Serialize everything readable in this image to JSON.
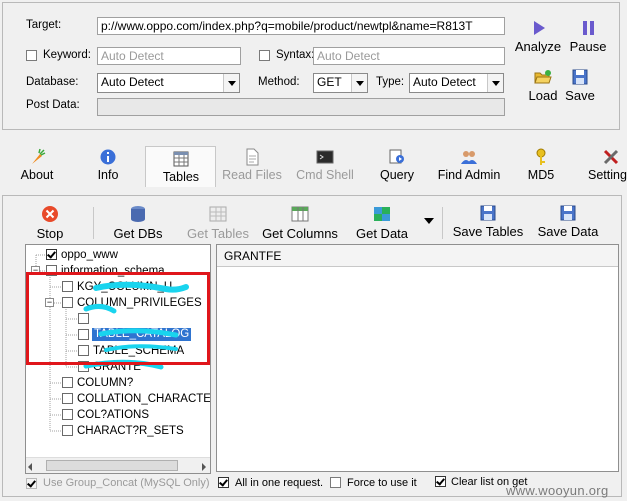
{
  "form": {
    "target_label": "Target:",
    "target_value": "p://www.oppo.com/index.php?q=mobile/product/newtpl&name=R813T",
    "keyword_label": "Keyword:",
    "keyword_placeholder": "Auto Detect",
    "syntax_label": "Syntax:",
    "syntax_placeholder": "Auto Detect",
    "database_label": "Database:",
    "database_value": "Auto Detect",
    "method_label": "Method:",
    "method_value": "GET",
    "type_label": "Type:",
    "type_value": "Auto Detect",
    "postdata_label": "Post Data:"
  },
  "actions": {
    "analyze": "Analyze",
    "pause": "Pause",
    "load": "Load",
    "save": "Save"
  },
  "tabs": [
    {
      "label": "About",
      "icon": "carrot-icon"
    },
    {
      "label": "Info",
      "icon": "info-icon"
    },
    {
      "label": "Tables",
      "icon": "table-icon"
    },
    {
      "label": "Read Files",
      "icon": "file-icon"
    },
    {
      "label": "Cmd Shell",
      "icon": "terminal-icon"
    },
    {
      "label": "Query",
      "icon": "query-icon"
    },
    {
      "label": "Find Admin",
      "icon": "users-icon"
    },
    {
      "label": "MD5",
      "icon": "key-icon"
    },
    {
      "label": "Setting",
      "icon": "tools-icon"
    }
  ],
  "toolbar": {
    "stop": "Stop",
    "get_dbs": "Get DBs",
    "get_tables": "Get Tables",
    "get_columns": "Get Columns",
    "get_data": "Get Data",
    "save_tables": "Save Tables",
    "save_data": "Save Data"
  },
  "tree": {
    "db1": "oppo_www",
    "db2": "information_schema",
    "t1": "KGY_COLUMN_U",
    "t2": "COLUMN_PRIVILEGES",
    "c1": "",
    "c2": "TABLE_CATALOG",
    "c3": "TABLE_SCHEMA",
    "c4": "GRANTE",
    "t3": "COLUMN?",
    "t4": "COLLATION_CHARACTER",
    "t5": "COL?ATIONS",
    "t6": "CHARACT?R_SETS"
  },
  "results": {
    "column_header": "GRANTFE"
  },
  "bottom": {
    "group_concat": "Use Group_Concat (MySQL Only)",
    "all_in_one": "All in one request.",
    "force": "Force to use it",
    "clear_list": "Clear list on get"
  },
  "watermark": "www.wooyun.org",
  "colors": {
    "highlight": "#2f74d0",
    "red_box": "#e0161b",
    "scribble": "#19d4ee"
  }
}
